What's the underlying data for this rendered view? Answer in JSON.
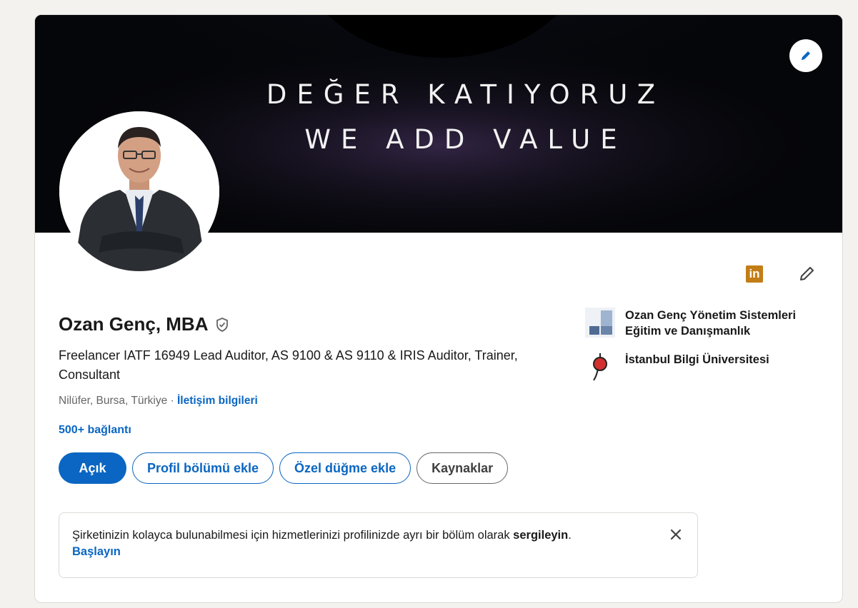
{
  "banner": {
    "line1": "DEĞER KATIYORUZ",
    "line2": "WE ADD VALUE"
  },
  "profile": {
    "name": "Ozan Genç, MBA",
    "headline": "Freelancer IATF 16949 Lead Auditor, AS 9100 & AS 9110 & IRIS Auditor, Trainer, Consultant",
    "location": "Nilüfer, Bursa, Türkiye",
    "location_sep": " · ",
    "contact_link": "İletişim bilgileri",
    "connections": "500+ bağlantı"
  },
  "icons": {
    "linkedin_badge_text": "in",
    "banner_edit": "pencil-icon",
    "intro_edit": "pencil-icon",
    "verified": "shield-check-icon",
    "close": "close-icon"
  },
  "actions": {
    "open": "Açık",
    "add_section": "Profil bölümü ekle",
    "custom_button": "Özel düğme ekle",
    "resources": "Kaynaklar"
  },
  "sidebar": {
    "company": "Ozan Genç Yönetim Sistemleri Eğitim ve Danışmanlık",
    "school": "İstanbul Bilgi Üniversitesi"
  },
  "notice": {
    "text_before": "Şirketinizin kolayca bulunabilmesi için hizmetlerinizi profilinizde ayrı bir bölüm olarak ",
    "text_bold": "sergileyin",
    "text_after": ".",
    "cta": "Başlayın"
  },
  "colors": {
    "accent": "#0a66c2",
    "page_bg": "#f4f2ee",
    "linkedin_badge": "#c37d16"
  }
}
